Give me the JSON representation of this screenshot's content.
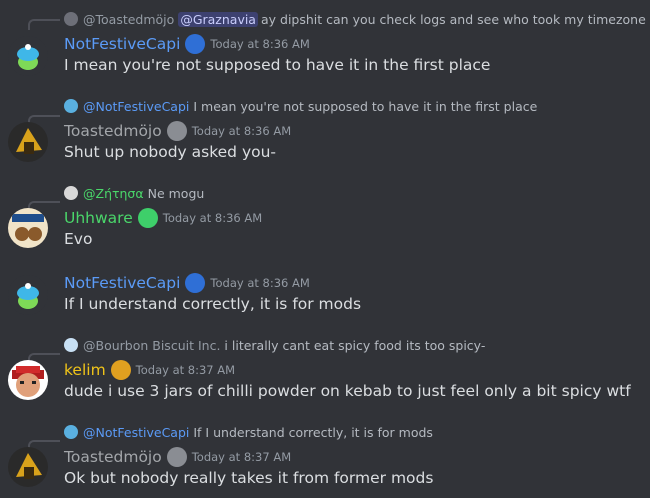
{
  "colors": {
    "background": "#313338",
    "name_blue": "#5b9bf7",
    "name_gray": "#a3a6aa",
    "name_green": "#4ad66a",
    "name_gold": "#f0c419",
    "mention_bg": "#3c4270",
    "muted": "#949ba4"
  },
  "messages": [
    {
      "reply": {
        "author": "@Toastedmöjo",
        "mention": "@Graznavia",
        "text": "ay dipshit can you check logs and see who took my timezone role"
      },
      "author": "NotFestiveCapi",
      "badge_icon": "blue-globe-icon",
      "timestamp": "Today at 8:36 AM",
      "text": "I mean you're not supposed to have it in the first place"
    },
    {
      "reply": {
        "author": "@NotFestiveCapi",
        "text": "I mean you're not supposed to have it in the first place"
      },
      "author": "Toastedmöjo",
      "badge_icon": "gray-avatar-icon",
      "timestamp": "Today at 8:36 AM",
      "text": "Shut up nobody asked you-"
    },
    {
      "reply": {
        "author": "@Ζήτησα",
        "text": "Ne mogu"
      },
      "author": "Uhhware",
      "badge_icon": "green-leaf-icon",
      "timestamp": "Today at 8:36 AM",
      "text": "Evo"
    },
    {
      "author": "NotFestiveCapi",
      "badge_icon": "blue-globe-icon",
      "timestamp": "Today at 8:36 AM",
      "text": "If I understand correctly, it is for mods"
    },
    {
      "reply": {
        "author": "@Bourbon Biscuit Inc.",
        "text": "i literally cant eat spicy food its too spicy-"
      },
      "author": "kelim",
      "badge_icon": "gold-knot-icon",
      "timestamp": "Today at 8:37 AM",
      "text": "dude i use 3 jars of chilli powder on kebab to just feel only a bit spicy wtf"
    },
    {
      "reply": {
        "author": "@NotFestiveCapi",
        "text": "If I understand correctly, it is for mods"
      },
      "author": "Toastedmöjo",
      "badge_icon": "gray-avatar-icon",
      "timestamp": "Today at 8:37 AM",
      "text": "Ok but nobody really takes it from former mods"
    }
  ]
}
